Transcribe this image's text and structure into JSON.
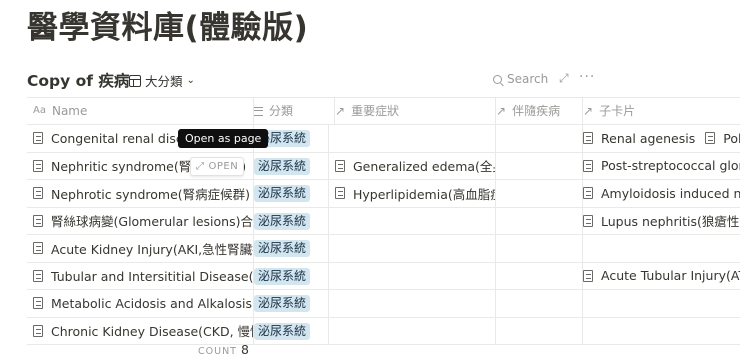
{
  "page": {
    "title": "醫學資料庫(體驗版)"
  },
  "database": {
    "title": "Copy of 疾病",
    "view_label": "大分類",
    "search_label": "Search"
  },
  "columns": [
    {
      "label": "Name",
      "icon": "text-property-icon"
    },
    {
      "label": "分類",
      "icon": "list-property-icon"
    },
    {
      "label": "重要症狀",
      "icon": "relation-arrow-icon"
    },
    {
      "label": "伴隨疾病",
      "icon": "relation-arrow-icon"
    },
    {
      "label": "子卡片",
      "icon": "relation-arrow-icon"
    }
  ],
  "rows": [
    {
      "name": "Congenital renal disease",
      "category": "泌尿系統",
      "symptoms": [],
      "comorbid": [],
      "children": [
        "Renal agenesis",
        "Polycystic"
      ]
    },
    {
      "name": "Nephritic syndrome(腎炎症候群)",
      "category": "泌尿系統",
      "symptoms": [
        "Generalized edema(全身水腫)"
      ],
      "comorbid": [],
      "children": [
        "Post-streptococcal glomerulonephritis"
      ]
    },
    {
      "name": "Nephrotic syndrome(腎病症候群)",
      "category": "泌尿系統",
      "symptoms": [
        "Hyperlipidemia(高血脂症)"
      ],
      "comorbid": [],
      "children": [
        "Amyloidosis induced nephropathy"
      ]
    },
    {
      "name": "腎絲球病變(Glomerular lesions)合併全身性疾病",
      "category": "泌尿系統",
      "symptoms": [],
      "comorbid": [],
      "children": [
        "Lupus nephritis(狼瘡性腎炎)"
      ]
    },
    {
      "name": "Acute Kidney Injury(AKI,急性腎臟損傷)",
      "category": "泌尿系統",
      "symptoms": [],
      "comorbid": [],
      "children": []
    },
    {
      "name": "Tubular and Intersititial Disease(腎小管間質疾病)",
      "category": "泌尿系統",
      "symptoms": [],
      "comorbid": [],
      "children": [
        "Acute Tubular Injury(ATI)"
      ]
    },
    {
      "name": "Metabolic Acidosis and Alkalosis",
      "category": "泌尿系統",
      "symptoms": [],
      "comorbid": [],
      "children": []
    },
    {
      "name": "Chronic Kidney Disease(CKD, 慢性腎臟病)",
      "category": "泌尿系統",
      "symptoms": [],
      "comorbid": [],
      "children": []
    }
  ],
  "hover": {
    "open_label": "OPEN",
    "tooltip": "Open as page"
  },
  "footer": {
    "count_label": "COUNT",
    "count_value": "8"
  },
  "colors": {
    "tag_bg": "#d3e5ef",
    "tag_text": "#183347",
    "text": "#37352f",
    "muted": "#9b9a97"
  }
}
